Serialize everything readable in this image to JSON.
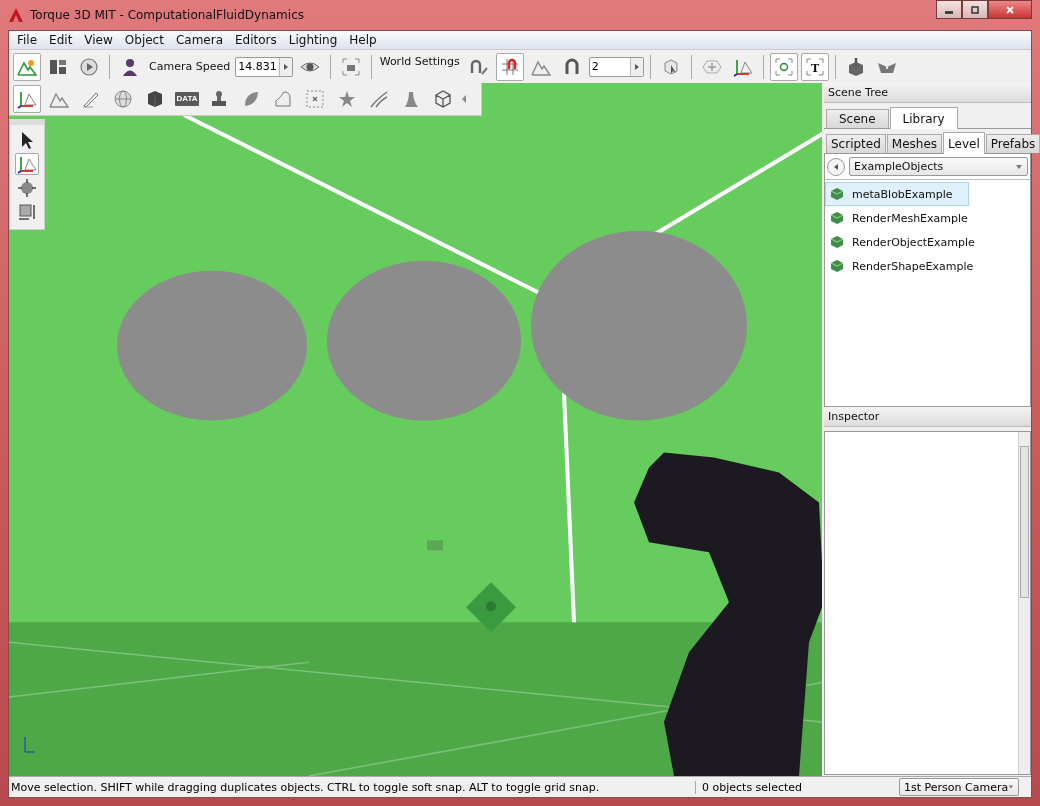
{
  "window": {
    "title": "Torque 3D MIT - ComputationalFluidDynamics"
  },
  "menu": [
    "File",
    "Edit",
    "View",
    "Object",
    "Camera",
    "Editors",
    "Lighting",
    "Help"
  ],
  "main_toolbar": {
    "buttons": [
      {
        "selected": true
      },
      {
        "selected": false
      },
      {
        "selected": false
      },
      {
        "selected": false
      },
      {
        "selected": false
      },
      {
        "selected": false
      },
      {
        "selected": false
      },
      {
        "selected": true
      },
      {
        "selected": false
      },
      {
        "selected": false
      },
      {
        "selected": false
      },
      {
        "selected": false
      },
      {
        "selected": false
      },
      {
        "selected": true
      },
      {
        "selected": true,
        "label": "T"
      },
      {
        "selected": false
      },
      {
        "selected": false
      }
    ],
    "camera_speed": {
      "label": "Camera Speed",
      "value": "14.831"
    },
    "world_settings": "World Settings",
    "snap_value": "2"
  },
  "editor_toolbar": {
    "buttons": [
      {
        "selected": true
      },
      {
        "selected": false
      },
      {
        "selected": false
      },
      {
        "selected": false
      },
      {
        "selected": false
      },
      {
        "selected": false,
        "label": "DATA"
      },
      {
        "selected": false
      },
      {
        "selected": false
      },
      {
        "selected": false
      },
      {
        "selected": false
      },
      {
        "selected": false
      },
      {
        "selected": false
      },
      {
        "selected": false
      },
      {
        "selected": false
      }
    ]
  },
  "tool_palette": [
    {
      "selected": false
    },
    {
      "selected": true
    },
    {
      "selected": false
    },
    {
      "selected": false
    }
  ],
  "scene_tree": {
    "title": "Scene Tree",
    "tabs": [
      {
        "label": "Scene",
        "selected": false
      },
      {
        "label": "Library",
        "selected": true
      }
    ],
    "subtabs": [
      {
        "label": "Scripted",
        "selected": false
      },
      {
        "label": "Meshes",
        "selected": false
      },
      {
        "label": "Level",
        "selected": true
      },
      {
        "label": "Prefabs",
        "selected": false
      }
    ],
    "folder": "ExampleObjects",
    "items": [
      {
        "label": "metaBlobExample",
        "selected": true
      },
      {
        "label": "RenderMeshExample",
        "selected": false
      },
      {
        "label": "RenderObjectExample",
        "selected": false
      },
      {
        "label": "RenderShapeExample",
        "selected": false
      }
    ]
  },
  "inspector": {
    "title": "Inspector"
  },
  "status_bar": {
    "message": "Move selection.  SHIFT while dragging duplicates objects.  CTRL to toggle soft snap.  ALT to toggle grid snap.",
    "selection": "0 objects selected",
    "camera": "1st Person Camera"
  }
}
